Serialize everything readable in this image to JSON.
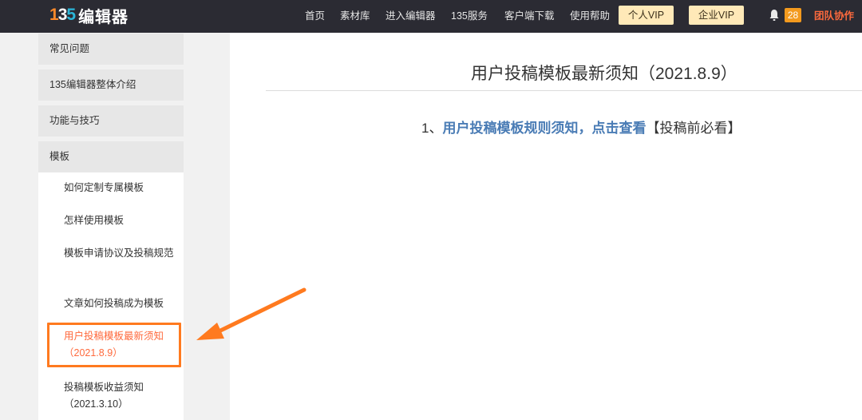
{
  "header": {
    "logo_number": "135",
    "logo_text": "编辑器",
    "nav": [
      "首页",
      "素材库",
      "进入编辑器",
      "135服务",
      "客户端下载",
      "使用帮助"
    ],
    "vip_personal": "个人VIP",
    "vip_enterprise": "企业VIP",
    "notification_count": "28",
    "team": "团队协作"
  },
  "sidebar": {
    "sections": [
      "常见问题",
      "135编辑器整体介绍",
      "功能与技巧",
      "模板"
    ],
    "items": [
      "如何定制专属模板",
      "怎样使用模板",
      "模板申请协议及投稿规范",
      "文章如何投稿成为模板",
      "用户投稿模板最新须知（2021.8.9）",
      "投稿模板收益须知（2021.3.10）"
    ]
  },
  "article": {
    "title": "用户投稿模板最新须知（2021.8.9）",
    "rule_number": "1、",
    "rule_link": "用户投稿模板规则须知，点击查看",
    "rule_note": "【投稿前必看】"
  },
  "colors": {
    "topbar": "#2b2b33",
    "accent": "#ff7a1f",
    "link": "#4a7cb5",
    "vip": "#ffe9b8"
  }
}
